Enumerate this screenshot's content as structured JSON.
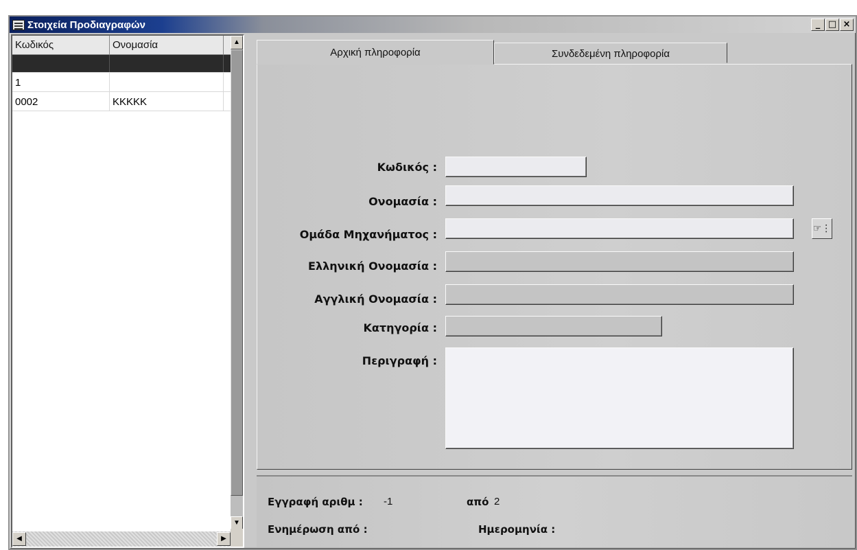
{
  "window": {
    "title": "Στοιχεία Προδιαγραφών",
    "controls": {
      "minimize": "_",
      "maximize": "□",
      "close": "×"
    }
  },
  "grid": {
    "columns": [
      "Κωδικός",
      "Ονομασία"
    ],
    "rows": [
      {
        "code": "",
        "name": ""
      },
      {
        "code": "1",
        "name": ""
      },
      {
        "code": "0002",
        "name": "KKKKK"
      }
    ],
    "selected_row": 0
  },
  "tabs": [
    {
      "label": "Αρχική πληροφορία",
      "active": true
    },
    {
      "label": "Συνδεδεμένη πληροφορία",
      "active": false
    }
  ],
  "form": {
    "code_label": "Κωδικός :",
    "code_value": "",
    "name_label": "Ονομασία :",
    "name_value": "",
    "group_label": "Ομάδα Μηχανήματος :",
    "group_value": "",
    "greek_name_label": "Ελληνική Ονομασία :",
    "greek_name_value": "",
    "english_name_label": "Αγγλική Ονομασία :",
    "english_name_value": "",
    "category_label": "Κατηγορία :",
    "category_value": "",
    "description_label": "Περιγραφή :",
    "description_value": "",
    "lookup_icon": "hand-pointer-icon"
  },
  "status": {
    "record_label": "Εγγραφή αριθμ :",
    "record_value": "-1",
    "of_label": "από",
    "of_value": "2",
    "updated_by_label": "Ενημέρωση από :",
    "updated_by_value": "",
    "date_label": "Ημερομηνία :",
    "date_value": ""
  }
}
